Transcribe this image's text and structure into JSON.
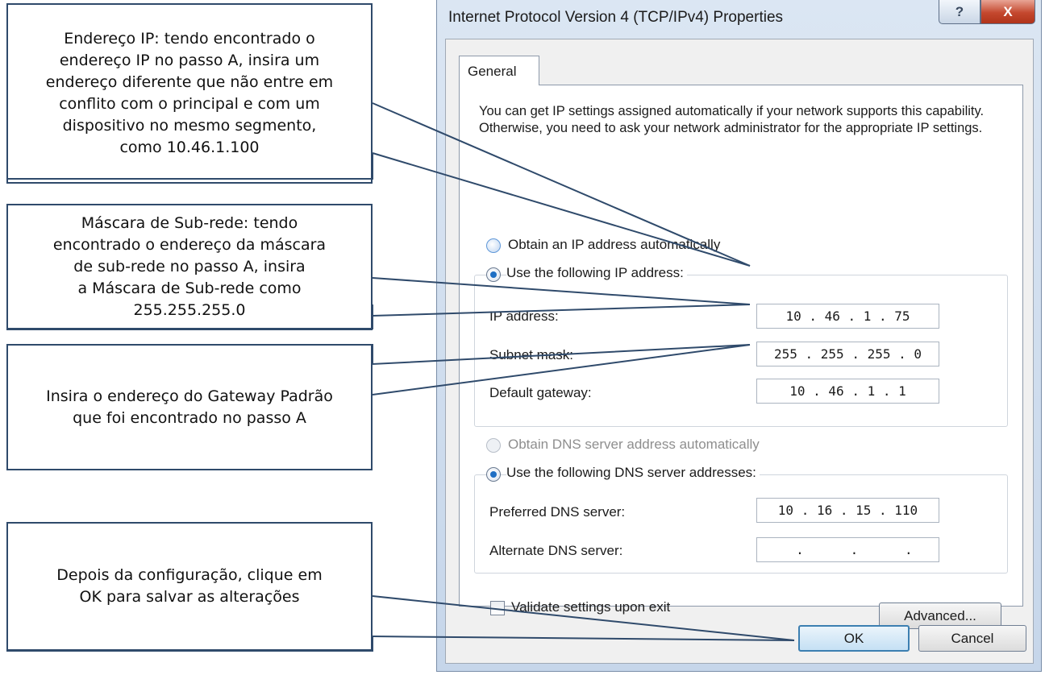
{
  "callouts": [
    {
      "lines": [
        "Endereço IP: tendo encontrado o",
        "endereço IP no passo A, insira um",
        "endereço diferente que não entre em",
        "conflito com o principal e com um",
        "dispositivo no mesmo segmento,",
        "como 10.46.1.100"
      ]
    },
    {
      "lines": [
        "Máscara de Sub-rede: tendo",
        "encontrado o endereço da máscara",
        "de sub-rede no passo A, insira",
        "a Máscara de Sub-rede como",
        "255.255.255.0"
      ]
    },
    {
      "lines": [
        "Insira o endereço do Gateway Padrão",
        "que foi encontrado no passo A"
      ]
    },
    {
      "lines": [
        "Depois da configuração, clique em",
        "OK para salvar as alterações"
      ]
    }
  ],
  "dialog": {
    "title": "Internet Protocol Version 4 (TCP/IPv4) Properties",
    "help_symbol": "?",
    "close_symbol": "X",
    "tab": "General",
    "description": "You can get IP settings assigned automatically if your network supports this capability. Otherwise, you need to ask your network administrator for the appropriate IP settings.",
    "ip_section": {
      "auto_label": "Obtain an IP address automatically",
      "manual_label": "Use the following IP address:",
      "fields": [
        {
          "label": "IP address:",
          "value": "10 . 46 . 1 . 75"
        },
        {
          "label": "Subnet mask:",
          "value": "255 . 255 . 255 . 0"
        },
        {
          "label": "Default gateway:",
          "value": "10 . 46 . 1 . 1"
        }
      ]
    },
    "dns_section": {
      "auto_label": "Obtain DNS server address automatically",
      "manual_label": "Use the following DNS server addresses:",
      "fields": [
        {
          "label": "Preferred DNS server:",
          "value": "10 . 16 . 15 . 110"
        },
        {
          "label": "Alternate DNS server:",
          "value": "     .      .      .     "
        }
      ]
    },
    "validate_label": "Validate settings upon exit",
    "advanced_label": "Advanced...",
    "ok_label": "OK",
    "cancel_label": "Cancel"
  },
  "colors": {
    "callout_border": "#2f4a6b",
    "leader_line": "#2f4a6b",
    "radio_checked": "#1f6fc4",
    "close_button": "#c4482e"
  }
}
